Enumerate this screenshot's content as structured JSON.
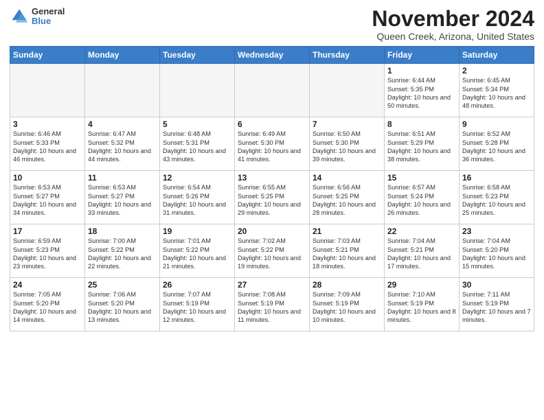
{
  "header": {
    "logo_general": "General",
    "logo_blue": "Blue",
    "month_title": "November 2024",
    "location": "Queen Creek, Arizona, United States"
  },
  "weekdays": [
    "Sunday",
    "Monday",
    "Tuesday",
    "Wednesday",
    "Thursday",
    "Friday",
    "Saturday"
  ],
  "weeks": [
    [
      {
        "day": "",
        "empty": true
      },
      {
        "day": "",
        "empty": true
      },
      {
        "day": "",
        "empty": true
      },
      {
        "day": "",
        "empty": true
      },
      {
        "day": "",
        "empty": true
      },
      {
        "day": "1",
        "sunrise": "Sunrise: 6:44 AM",
        "sunset": "Sunset: 5:35 PM",
        "daylight": "Daylight: 10 hours and 50 minutes."
      },
      {
        "day": "2",
        "sunrise": "Sunrise: 6:45 AM",
        "sunset": "Sunset: 5:34 PM",
        "daylight": "Daylight: 10 hours and 48 minutes."
      }
    ],
    [
      {
        "day": "3",
        "sunrise": "Sunrise: 6:46 AM",
        "sunset": "Sunset: 5:33 PM",
        "daylight": "Daylight: 10 hours and 46 minutes."
      },
      {
        "day": "4",
        "sunrise": "Sunrise: 6:47 AM",
        "sunset": "Sunset: 5:32 PM",
        "daylight": "Daylight: 10 hours and 44 minutes."
      },
      {
        "day": "5",
        "sunrise": "Sunrise: 6:48 AM",
        "sunset": "Sunset: 5:31 PM",
        "daylight": "Daylight: 10 hours and 43 minutes."
      },
      {
        "day": "6",
        "sunrise": "Sunrise: 6:49 AM",
        "sunset": "Sunset: 5:30 PM",
        "daylight": "Daylight: 10 hours and 41 minutes."
      },
      {
        "day": "7",
        "sunrise": "Sunrise: 6:50 AM",
        "sunset": "Sunset: 5:30 PM",
        "daylight": "Daylight: 10 hours and 39 minutes."
      },
      {
        "day": "8",
        "sunrise": "Sunrise: 6:51 AM",
        "sunset": "Sunset: 5:29 PM",
        "daylight": "Daylight: 10 hours and 38 minutes."
      },
      {
        "day": "9",
        "sunrise": "Sunrise: 6:52 AM",
        "sunset": "Sunset: 5:28 PM",
        "daylight": "Daylight: 10 hours and 36 minutes."
      }
    ],
    [
      {
        "day": "10",
        "sunrise": "Sunrise: 6:53 AM",
        "sunset": "Sunset: 5:27 PM",
        "daylight": "Daylight: 10 hours and 34 minutes."
      },
      {
        "day": "11",
        "sunrise": "Sunrise: 6:53 AM",
        "sunset": "Sunset: 5:27 PM",
        "daylight": "Daylight: 10 hours and 33 minutes."
      },
      {
        "day": "12",
        "sunrise": "Sunrise: 6:54 AM",
        "sunset": "Sunset: 5:26 PM",
        "daylight": "Daylight: 10 hours and 31 minutes."
      },
      {
        "day": "13",
        "sunrise": "Sunrise: 6:55 AM",
        "sunset": "Sunset: 5:25 PM",
        "daylight": "Daylight: 10 hours and 29 minutes."
      },
      {
        "day": "14",
        "sunrise": "Sunrise: 6:56 AM",
        "sunset": "Sunset: 5:25 PM",
        "daylight": "Daylight: 10 hours and 28 minutes."
      },
      {
        "day": "15",
        "sunrise": "Sunrise: 6:57 AM",
        "sunset": "Sunset: 5:24 PM",
        "daylight": "Daylight: 10 hours and 26 minutes."
      },
      {
        "day": "16",
        "sunrise": "Sunrise: 6:58 AM",
        "sunset": "Sunset: 5:23 PM",
        "daylight": "Daylight: 10 hours and 25 minutes."
      }
    ],
    [
      {
        "day": "17",
        "sunrise": "Sunrise: 6:59 AM",
        "sunset": "Sunset: 5:23 PM",
        "daylight": "Daylight: 10 hours and 23 minutes."
      },
      {
        "day": "18",
        "sunrise": "Sunrise: 7:00 AM",
        "sunset": "Sunset: 5:22 PM",
        "daylight": "Daylight: 10 hours and 22 minutes."
      },
      {
        "day": "19",
        "sunrise": "Sunrise: 7:01 AM",
        "sunset": "Sunset: 5:22 PM",
        "daylight": "Daylight: 10 hours and 21 minutes."
      },
      {
        "day": "20",
        "sunrise": "Sunrise: 7:02 AM",
        "sunset": "Sunset: 5:22 PM",
        "daylight": "Daylight: 10 hours and 19 minutes."
      },
      {
        "day": "21",
        "sunrise": "Sunrise: 7:03 AM",
        "sunset": "Sunset: 5:21 PM",
        "daylight": "Daylight: 10 hours and 18 minutes."
      },
      {
        "day": "22",
        "sunrise": "Sunrise: 7:04 AM",
        "sunset": "Sunset: 5:21 PM",
        "daylight": "Daylight: 10 hours and 17 minutes."
      },
      {
        "day": "23",
        "sunrise": "Sunrise: 7:04 AM",
        "sunset": "Sunset: 5:20 PM",
        "daylight": "Daylight: 10 hours and 15 minutes."
      }
    ],
    [
      {
        "day": "24",
        "sunrise": "Sunrise: 7:05 AM",
        "sunset": "Sunset: 5:20 PM",
        "daylight": "Daylight: 10 hours and 14 minutes."
      },
      {
        "day": "25",
        "sunrise": "Sunrise: 7:06 AM",
        "sunset": "Sunset: 5:20 PM",
        "daylight": "Daylight: 10 hours and 13 minutes."
      },
      {
        "day": "26",
        "sunrise": "Sunrise: 7:07 AM",
        "sunset": "Sunset: 5:19 PM",
        "daylight": "Daylight: 10 hours and 12 minutes."
      },
      {
        "day": "27",
        "sunrise": "Sunrise: 7:08 AM",
        "sunset": "Sunset: 5:19 PM",
        "daylight": "Daylight: 10 hours and 11 minutes."
      },
      {
        "day": "28",
        "sunrise": "Sunrise: 7:09 AM",
        "sunset": "Sunset: 5:19 PM",
        "daylight": "Daylight: 10 hours and 10 minutes."
      },
      {
        "day": "29",
        "sunrise": "Sunrise: 7:10 AM",
        "sunset": "Sunset: 5:19 PM",
        "daylight": "Daylight: 10 hours and 8 minutes."
      },
      {
        "day": "30",
        "sunrise": "Sunrise: 7:11 AM",
        "sunset": "Sunset: 5:19 PM",
        "daylight": "Daylight: 10 hours and 7 minutes."
      }
    ]
  ]
}
